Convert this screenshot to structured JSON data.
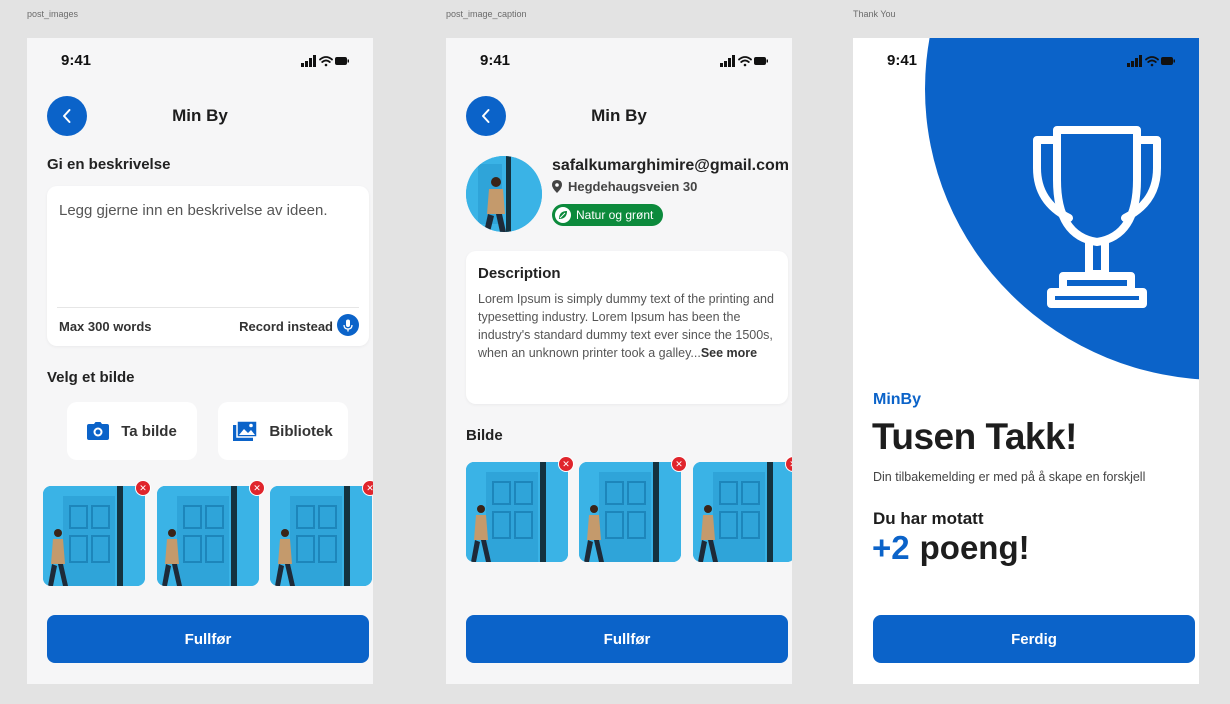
{
  "frames": {
    "post_images": "post_images",
    "post_image_caption": "post_image_caption",
    "thank_you": "Thank You"
  },
  "status": {
    "time": "9:41"
  },
  "colors": {
    "primary": "#0b63c9",
    "danger": "#e0252c",
    "tag_green": "#0c8a3c",
    "photo_blue": "#3ab3e6"
  },
  "screen1": {
    "title": "Min By",
    "description_heading": "Gi en beskrivelse",
    "description_placeholder": "Legg gjerne inn en beskrivelse av ideen.",
    "max_words": "Max 300 words",
    "record_label": "Record instead",
    "image_heading": "Velg et bilde",
    "camera_label": "Ta bilde",
    "library_label": "Bibliotek",
    "thumbnails": 3,
    "submit_label": "Fullfør"
  },
  "screen2": {
    "title": "Min By",
    "email": "safalkumarghimire@gmail.com",
    "address": "Hegdehaugsveien 30",
    "category": "Natur og grønt",
    "description_heading": "Description",
    "description_text": "Lorem Ipsum is simply dummy text of the printing and typesetting industry. Lorem Ipsum has been the industry's standard dummy text ever since the 1500s, when an unknown printer took a galley...",
    "see_more": "See more",
    "image_heading": "Bilde",
    "thumbnails": 3,
    "submit_label": "Fullfør"
  },
  "screen3": {
    "brand": "MinBy",
    "title": "Tusen Takk!",
    "subtitle": "Din tilbakemelding er med på å skape en forskjell",
    "received": "Du har motatt",
    "points_plus": "+2",
    "points_word": "poeng!",
    "done_label": "Ferdig"
  }
}
